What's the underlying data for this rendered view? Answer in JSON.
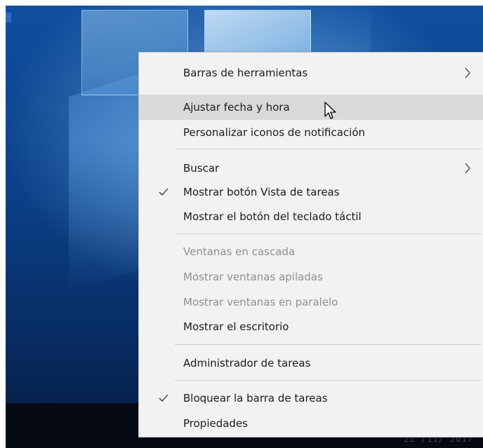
{
  "desktop": {
    "tray_time": "22 /11/ 2017"
  },
  "context_menu": {
    "items": [
      {
        "label": "Barras de herramientas",
        "submenu_icon": "chevron-right-icon"
      },
      {
        "label": "Ajustar fecha y hora",
        "state": "hovered"
      },
      {
        "label": "Personalizar iconos de notificación"
      },
      {
        "label": "Buscar",
        "submenu_icon": "chevron-right-icon"
      },
      {
        "label": "Mostrar botón Vista de tareas",
        "checked": true
      },
      {
        "label": "Mostrar el botón del teclado táctil"
      },
      {
        "label": "Ventanas en cascada",
        "disabled": true
      },
      {
        "label": "Mostrar ventanas apiladas",
        "disabled": true
      },
      {
        "label": "Mostrar ventanas en paralelo",
        "disabled": true
      },
      {
        "label": "Mostrar el escritorio"
      },
      {
        "label": "Administrador de tareas"
      },
      {
        "label": "Bloquear la barra de tareas",
        "checked": true
      },
      {
        "label": "Propiedades"
      }
    ]
  },
  "colors": {
    "menu_background": "#f2f2f2",
    "hover_background": "#dadada",
    "disabled_text": "#8f8f8f",
    "desktop_blue": "#0a3f85"
  }
}
